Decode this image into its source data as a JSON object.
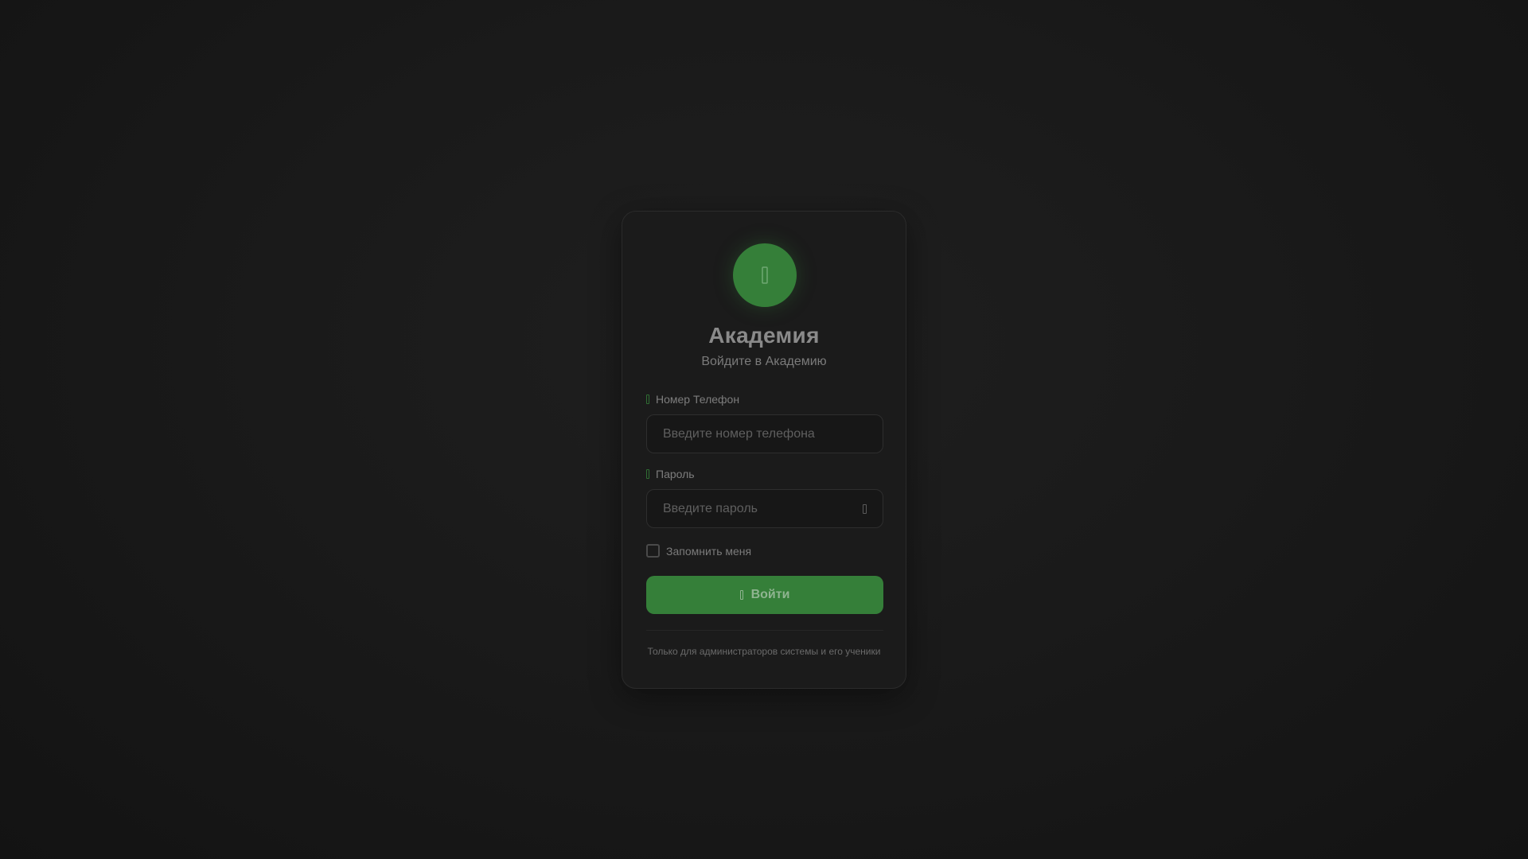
{
  "app": {
    "title": "Академия",
    "subtitle": "Войдите в Академию",
    "logo_icon": "graduation-cap-icon"
  },
  "form": {
    "phone": {
      "label": "Номер Телефон",
      "placeholder": "Введите номер телефона",
      "value": "",
      "icon": "phone-icon"
    },
    "password": {
      "label": "Пароль",
      "placeholder": "Введите пароль",
      "value": "",
      "icon": "lock-icon",
      "toggle_icon": "eye-icon"
    },
    "remember": {
      "label": "Запомнить меня",
      "checked": false
    },
    "submit": {
      "label": "Войти",
      "icon": "sign-in-icon"
    }
  },
  "footer": {
    "note": "Только для администраторов системы и его ученики"
  },
  "colors": {
    "accent": "#357f39",
    "background": "#1a1a1a",
    "card": "#1b1b1b"
  }
}
